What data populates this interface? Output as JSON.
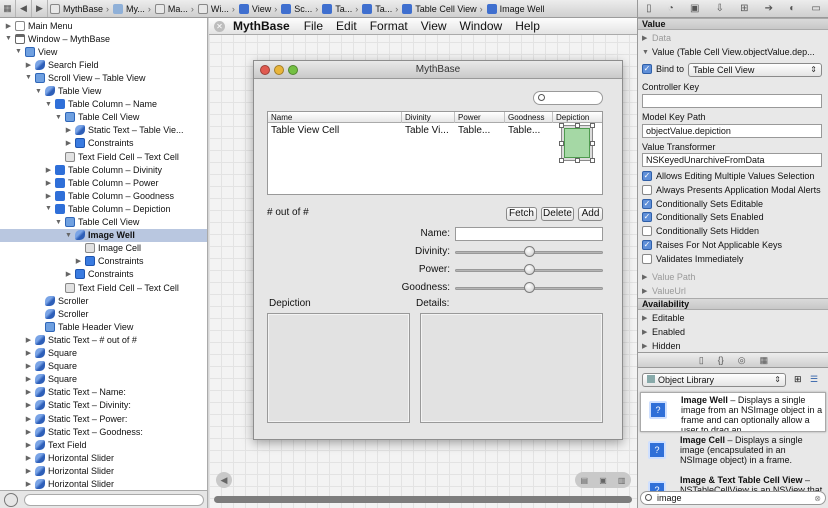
{
  "jumpbar": {
    "crumbs": [
      "MythBase",
      "My...",
      "Ma...",
      "Wi...",
      "View",
      "Sc...",
      "Ta...",
      "Ta...",
      "Table Cell View",
      "Image Well"
    ]
  },
  "outline": {
    "rows": [
      {
        "label": "Main Menu",
        "icon": "menu-icon",
        "indent": 0,
        "disclosure": "▶"
      },
      {
        "label": "Window – MythBase",
        "icon": "window-icon",
        "indent": 0,
        "disclosure": "▼"
      },
      {
        "label": "View",
        "icon": "view-icon",
        "indent": 1,
        "disclosure": "▼"
      },
      {
        "label": "Search Field",
        "icon": "control-icon",
        "indent": 2,
        "disclosure": "▶"
      },
      {
        "label": "Scroll View – Table View",
        "icon": "view-icon",
        "indent": 2,
        "disclosure": "▼"
      },
      {
        "label": "Table View",
        "icon": "control-icon",
        "indent": 3,
        "disclosure": "▼"
      },
      {
        "label": "Table Column – Name",
        "icon": "column-icon",
        "indent": 4,
        "disclosure": "▼"
      },
      {
        "label": "Table Cell View",
        "icon": "view-icon",
        "indent": 5,
        "disclosure": "▼"
      },
      {
        "label": "Static Text – Table Vie...",
        "icon": "control-icon",
        "indent": 6,
        "disclosure": "▶"
      },
      {
        "label": "Constraints",
        "icon": "constraints-icon",
        "indent": 6,
        "disclosure": "▶"
      },
      {
        "label": "Text Field Cell – Text Cell",
        "icon": "cell-icon",
        "indent": 5,
        "disclosure": ""
      },
      {
        "label": "Table Column – Divinity",
        "icon": "column-icon",
        "indent": 4,
        "disclosure": "▶"
      },
      {
        "label": "Table Column – Power",
        "icon": "column-icon",
        "indent": 4,
        "disclosure": "▶"
      },
      {
        "label": "Table Column – Goodness",
        "icon": "column-icon",
        "indent": 4,
        "disclosure": "▶"
      },
      {
        "label": "Table Column – Depiction",
        "icon": "column-icon",
        "indent": 4,
        "disclosure": "▼"
      },
      {
        "label": "Table Cell View",
        "icon": "view-icon",
        "indent": 5,
        "disclosure": "▼"
      },
      {
        "label": "Image Well",
        "icon": "control-icon",
        "indent": 6,
        "disclosure": "▼",
        "selected": true
      },
      {
        "label": "Image Cell",
        "icon": "cell-icon",
        "indent": 7,
        "disclosure": ""
      },
      {
        "label": "Constraints",
        "icon": "constraints-icon",
        "indent": 7,
        "disclosure": "▶"
      },
      {
        "label": "Constraints",
        "icon": "constraints-icon",
        "indent": 6,
        "disclosure": "▶"
      },
      {
        "label": "Text Field Cell – Text Cell",
        "icon": "cell-icon",
        "indent": 5,
        "disclosure": ""
      },
      {
        "label": "Scroller",
        "icon": "control-icon",
        "indent": 3,
        "disclosure": ""
      },
      {
        "label": "Scroller",
        "icon": "control-icon",
        "indent": 3,
        "disclosure": ""
      },
      {
        "label": "Table Header View",
        "icon": "view-icon",
        "indent": 3,
        "disclosure": ""
      },
      {
        "label": "Static Text – # out of #",
        "icon": "control-icon",
        "indent": 2,
        "disclosure": "▶"
      },
      {
        "label": "Square",
        "icon": "control-icon",
        "indent": 2,
        "disclosure": "▶"
      },
      {
        "label": "Square",
        "icon": "control-icon",
        "indent": 2,
        "disclosure": "▶"
      },
      {
        "label": "Square",
        "icon": "control-icon",
        "indent": 2,
        "disclosure": "▶"
      },
      {
        "label": "Static Text – Name:",
        "icon": "control-icon",
        "indent": 2,
        "disclosure": "▶"
      },
      {
        "label": "Static Text – Divinity:",
        "icon": "control-icon",
        "indent": 2,
        "disclosure": "▶"
      },
      {
        "label": "Static Text – Power:",
        "icon": "control-icon",
        "indent": 2,
        "disclosure": "▶"
      },
      {
        "label": "Static Text – Goodness:",
        "icon": "control-icon",
        "indent": 2,
        "disclosure": "▶"
      },
      {
        "label": "Text Field",
        "icon": "control-icon",
        "indent": 2,
        "disclosure": "▶"
      },
      {
        "label": "Horizontal Slider",
        "icon": "control-icon",
        "indent": 2,
        "disclosure": "▶"
      },
      {
        "label": "Horizontal Slider",
        "icon": "control-icon",
        "indent": 2,
        "disclosure": "▶"
      },
      {
        "label": "Horizontal Slider",
        "icon": "control-icon",
        "indent": 2,
        "disclosure": "▶"
      }
    ]
  },
  "canvas": {
    "menubar": {
      "app": "MythBase",
      "items": [
        "File",
        "Edit",
        "Format",
        "View",
        "Window",
        "Help"
      ]
    },
    "window": {
      "title": "MythBase",
      "columns": [
        "Name",
        "Divinity",
        "Power",
        "Goodness",
        "Depiction"
      ],
      "row": [
        "Table View Cell",
        "Table Vi...",
        "Table...",
        "Table..."
      ],
      "count_label": "# out of #",
      "buttons": [
        "Fetch",
        "Delete",
        "Add"
      ],
      "fields": {
        "name": "Name:",
        "divinity": "Divinity:",
        "power": "Power:",
        "goodness": "Goodness:"
      },
      "sliders": {
        "divinity": 0.5,
        "power": 0.5,
        "goodness": 0.5
      },
      "depiction_label": "Depiction",
      "details_label": "Details:"
    }
  },
  "inspector": {
    "section_value": "Value",
    "data_row": "Data",
    "value_row": "Value (Table Cell View.objectValue.dep...",
    "bind_to_label": "Bind to",
    "bind_to_value": "Table Cell View",
    "controller_key_label": "Controller Key",
    "controller_key_value": "",
    "model_key_path_label": "Model Key Path",
    "model_key_path_value": "objectValue.depiction",
    "value_transformer_label": "Value Transformer",
    "value_transformer_value": "NSKeyedUnarchiveFromData",
    "options": [
      {
        "label": "Allows Editing Multiple Values Selection",
        "checked": true
      },
      {
        "label": "Always Presents Application Modal Alerts",
        "checked": false
      },
      {
        "label": "Conditionally Sets Editable",
        "checked": true
      },
      {
        "label": "Conditionally Sets Enabled",
        "checked": true
      },
      {
        "label": "Conditionally Sets Hidden",
        "checked": false
      },
      {
        "label": "Raises For Not Applicable Keys",
        "checked": true
      },
      {
        "label": "Validates Immediately",
        "checked": false
      }
    ],
    "value_path": "Value Path",
    "value_url": "ValueUrl",
    "section_availability": "Availability",
    "availability": [
      "Editable",
      "Enabled",
      "Hidden"
    ],
    "library_selector": "Object Library",
    "library_items": [
      {
        "title": "Image Well",
        "desc": " – Displays a single image from an NSImage object in a frame and can optionally allow a user to drag an..."
      },
      {
        "title": "Image Cell",
        "desc": " – Displays a single image (encapsulated in an NSImage object) in a frame."
      },
      {
        "title": "Image & Text Table Cell View",
        "desc": " – NSTableCellView is an NSView that is..."
      }
    ],
    "filter_value": "image"
  }
}
